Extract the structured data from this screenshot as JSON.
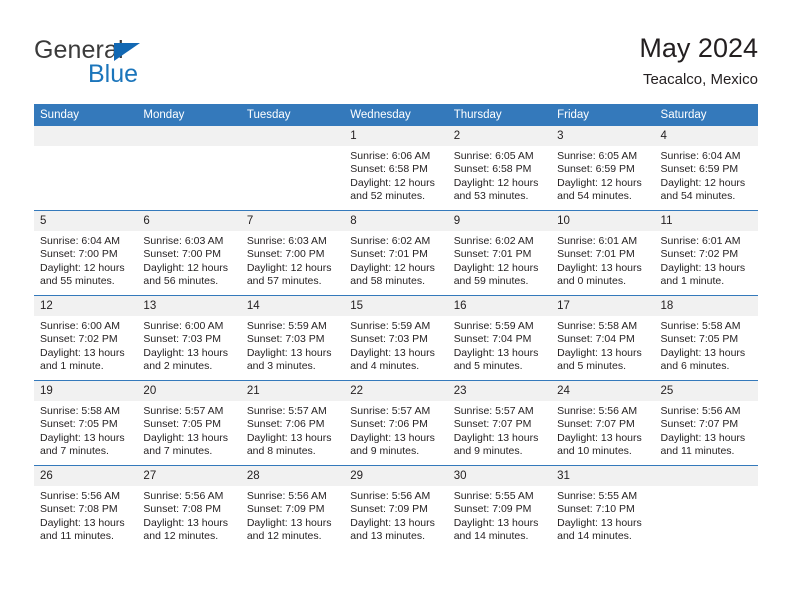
{
  "brand": {
    "name_top": "General",
    "name_bottom": "Blue",
    "triangle_color": "#1268b3",
    "blue_text_color": "#1b75bb"
  },
  "header": {
    "title": "May 2024",
    "location": "Teacalco, Mexico"
  },
  "theme": {
    "header_blue": "#3479bb",
    "daynum_strip": "#f1f1f1",
    "text": "#231f20"
  },
  "weekdays": [
    "Sunday",
    "Monday",
    "Tuesday",
    "Wednesday",
    "Thursday",
    "Friday",
    "Saturday"
  ],
  "labels": {
    "sunrise_prefix": "Sunrise:",
    "sunset_prefix": "Sunset:",
    "daylight_prefix": "Daylight:"
  },
  "weeks": [
    [
      {
        "day": "",
        "empty": true
      },
      {
        "day": "",
        "empty": true
      },
      {
        "day": "",
        "empty": true
      },
      {
        "day": "1",
        "sunrise": "Sunrise: 6:06 AM",
        "sunset": "Sunset: 6:58 PM",
        "daylight_line1": "Daylight: 12 hours",
        "daylight_line2": "and 52 minutes."
      },
      {
        "day": "2",
        "sunrise": "Sunrise: 6:05 AM",
        "sunset": "Sunset: 6:58 PM",
        "daylight_line1": "Daylight: 12 hours",
        "daylight_line2": "and 53 minutes."
      },
      {
        "day": "3",
        "sunrise": "Sunrise: 6:05 AM",
        "sunset": "Sunset: 6:59 PM",
        "daylight_line1": "Daylight: 12 hours",
        "daylight_line2": "and 54 minutes."
      },
      {
        "day": "4",
        "sunrise": "Sunrise: 6:04 AM",
        "sunset": "Sunset: 6:59 PM",
        "daylight_line1": "Daylight: 12 hours",
        "daylight_line2": "and 54 minutes."
      }
    ],
    [
      {
        "day": "5",
        "sunrise": "Sunrise: 6:04 AM",
        "sunset": "Sunset: 7:00 PM",
        "daylight_line1": "Daylight: 12 hours",
        "daylight_line2": "and 55 minutes."
      },
      {
        "day": "6",
        "sunrise": "Sunrise: 6:03 AM",
        "sunset": "Sunset: 7:00 PM",
        "daylight_line1": "Daylight: 12 hours",
        "daylight_line2": "and 56 minutes."
      },
      {
        "day": "7",
        "sunrise": "Sunrise: 6:03 AM",
        "sunset": "Sunset: 7:00 PM",
        "daylight_line1": "Daylight: 12 hours",
        "daylight_line2": "and 57 minutes."
      },
      {
        "day": "8",
        "sunrise": "Sunrise: 6:02 AM",
        "sunset": "Sunset: 7:01 PM",
        "daylight_line1": "Daylight: 12 hours",
        "daylight_line2": "and 58 minutes."
      },
      {
        "day": "9",
        "sunrise": "Sunrise: 6:02 AM",
        "sunset": "Sunset: 7:01 PM",
        "daylight_line1": "Daylight: 12 hours",
        "daylight_line2": "and 59 minutes."
      },
      {
        "day": "10",
        "sunrise": "Sunrise: 6:01 AM",
        "sunset": "Sunset: 7:01 PM",
        "daylight_line1": "Daylight: 13 hours",
        "daylight_line2": "and 0 minutes."
      },
      {
        "day": "11",
        "sunrise": "Sunrise: 6:01 AM",
        "sunset": "Sunset: 7:02 PM",
        "daylight_line1": "Daylight: 13 hours",
        "daylight_line2": "and 1 minute."
      }
    ],
    [
      {
        "day": "12",
        "sunrise": "Sunrise: 6:00 AM",
        "sunset": "Sunset: 7:02 PM",
        "daylight_line1": "Daylight: 13 hours",
        "daylight_line2": "and 1 minute."
      },
      {
        "day": "13",
        "sunrise": "Sunrise: 6:00 AM",
        "sunset": "Sunset: 7:03 PM",
        "daylight_line1": "Daylight: 13 hours",
        "daylight_line2": "and 2 minutes."
      },
      {
        "day": "14",
        "sunrise": "Sunrise: 5:59 AM",
        "sunset": "Sunset: 7:03 PM",
        "daylight_line1": "Daylight: 13 hours",
        "daylight_line2": "and 3 minutes."
      },
      {
        "day": "15",
        "sunrise": "Sunrise: 5:59 AM",
        "sunset": "Sunset: 7:03 PM",
        "daylight_line1": "Daylight: 13 hours",
        "daylight_line2": "and 4 minutes."
      },
      {
        "day": "16",
        "sunrise": "Sunrise: 5:59 AM",
        "sunset": "Sunset: 7:04 PM",
        "daylight_line1": "Daylight: 13 hours",
        "daylight_line2": "and 5 minutes."
      },
      {
        "day": "17",
        "sunrise": "Sunrise: 5:58 AM",
        "sunset": "Sunset: 7:04 PM",
        "daylight_line1": "Daylight: 13 hours",
        "daylight_line2": "and 5 minutes."
      },
      {
        "day": "18",
        "sunrise": "Sunrise: 5:58 AM",
        "sunset": "Sunset: 7:05 PM",
        "daylight_line1": "Daylight: 13 hours",
        "daylight_line2": "and 6 minutes."
      }
    ],
    [
      {
        "day": "19",
        "sunrise": "Sunrise: 5:58 AM",
        "sunset": "Sunset: 7:05 PM",
        "daylight_line1": "Daylight: 13 hours",
        "daylight_line2": "and 7 minutes."
      },
      {
        "day": "20",
        "sunrise": "Sunrise: 5:57 AM",
        "sunset": "Sunset: 7:05 PM",
        "daylight_line1": "Daylight: 13 hours",
        "daylight_line2": "and 7 minutes."
      },
      {
        "day": "21",
        "sunrise": "Sunrise: 5:57 AM",
        "sunset": "Sunset: 7:06 PM",
        "daylight_line1": "Daylight: 13 hours",
        "daylight_line2": "and 8 minutes."
      },
      {
        "day": "22",
        "sunrise": "Sunrise: 5:57 AM",
        "sunset": "Sunset: 7:06 PM",
        "daylight_line1": "Daylight: 13 hours",
        "daylight_line2": "and 9 minutes."
      },
      {
        "day": "23",
        "sunrise": "Sunrise: 5:57 AM",
        "sunset": "Sunset: 7:07 PM",
        "daylight_line1": "Daylight: 13 hours",
        "daylight_line2": "and 9 minutes."
      },
      {
        "day": "24",
        "sunrise": "Sunrise: 5:56 AM",
        "sunset": "Sunset: 7:07 PM",
        "daylight_line1": "Daylight: 13 hours",
        "daylight_line2": "and 10 minutes."
      },
      {
        "day": "25",
        "sunrise": "Sunrise: 5:56 AM",
        "sunset": "Sunset: 7:07 PM",
        "daylight_line1": "Daylight: 13 hours",
        "daylight_line2": "and 11 minutes."
      }
    ],
    [
      {
        "day": "26",
        "sunrise": "Sunrise: 5:56 AM",
        "sunset": "Sunset: 7:08 PM",
        "daylight_line1": "Daylight: 13 hours",
        "daylight_line2": "and 11 minutes."
      },
      {
        "day": "27",
        "sunrise": "Sunrise: 5:56 AM",
        "sunset": "Sunset: 7:08 PM",
        "daylight_line1": "Daylight: 13 hours",
        "daylight_line2": "and 12 minutes."
      },
      {
        "day": "28",
        "sunrise": "Sunrise: 5:56 AM",
        "sunset": "Sunset: 7:09 PM",
        "daylight_line1": "Daylight: 13 hours",
        "daylight_line2": "and 12 minutes."
      },
      {
        "day": "29",
        "sunrise": "Sunrise: 5:56 AM",
        "sunset": "Sunset: 7:09 PM",
        "daylight_line1": "Daylight: 13 hours",
        "daylight_line2": "and 13 minutes."
      },
      {
        "day": "30",
        "sunrise": "Sunrise: 5:55 AM",
        "sunset": "Sunset: 7:09 PM",
        "daylight_line1": "Daylight: 13 hours",
        "daylight_line2": "and 14 minutes."
      },
      {
        "day": "31",
        "sunrise": "Sunrise: 5:55 AM",
        "sunset": "Sunset: 7:10 PM",
        "daylight_line1": "Daylight: 13 hours",
        "daylight_line2": "and 14 minutes."
      },
      {
        "day": "",
        "empty": true
      }
    ]
  ]
}
